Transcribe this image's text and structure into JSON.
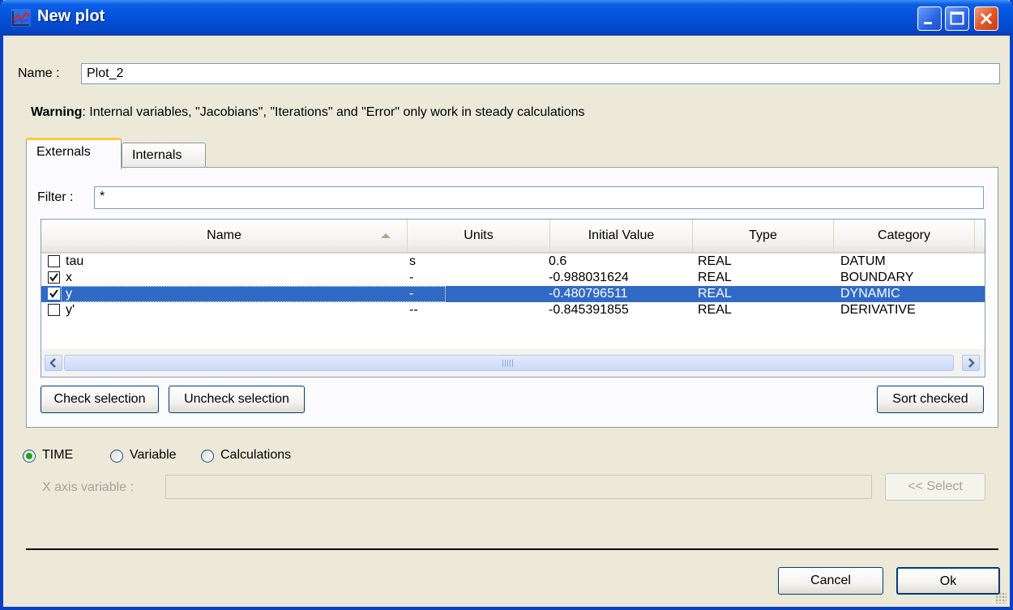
{
  "window": {
    "title": "New plot"
  },
  "name_field": {
    "label": "Name :",
    "value": "Plot_2"
  },
  "warning": {
    "bold": "Warning",
    "text": ": Internal variables, \"Jacobians\", \"Iterations\" and \"Error\" only work in steady calculations"
  },
  "tabs": [
    {
      "label": "Externals",
      "active": true
    },
    {
      "label": "Internals",
      "active": false
    }
  ],
  "filter": {
    "label": "Filter :",
    "value": "*"
  },
  "table": {
    "columns": [
      "Name",
      "Units",
      "Initial Value",
      "Type",
      "Category"
    ],
    "rows": [
      {
        "checked": false,
        "name": "tau",
        "units": "s",
        "initial_value": "0.6",
        "type": "REAL",
        "category": "DATUM"
      },
      {
        "checked": true,
        "name": "x",
        "units": "-",
        "initial_value": "-0.988031624",
        "type": "REAL",
        "category": "BOUNDARY"
      },
      {
        "checked": true,
        "name": "y",
        "units": "-",
        "initial_value": "-0.480796511",
        "type": "REAL",
        "category": "DYNAMIC",
        "selected": true
      },
      {
        "checked": false,
        "name": "y'",
        "units": "--",
        "initial_value": "-0.845391855",
        "type": "REAL",
        "category": "DERIVATIVE"
      }
    ]
  },
  "buttons": {
    "check_selection": "Check selection",
    "uncheck_selection": "Uncheck selection",
    "sort_checked": "Sort checked",
    "select": "<< Select",
    "cancel": "Cancel",
    "ok": "Ok"
  },
  "x_axis_mode": {
    "options": [
      "TIME",
      "Variable",
      "Calculations"
    ],
    "selected": "TIME"
  },
  "x_axis_variable": {
    "label": "X axis variable :",
    "value": ""
  },
  "colors": {
    "titlebar": "#0550d8",
    "selection": "#316ac5",
    "window_bg": "#ece9d8"
  }
}
